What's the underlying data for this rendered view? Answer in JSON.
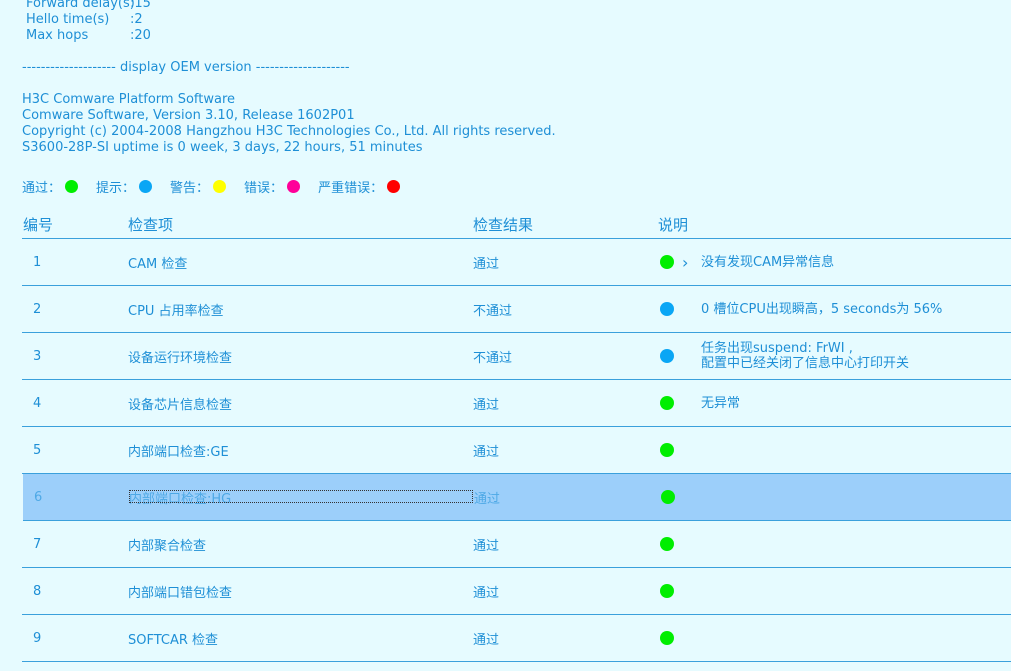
{
  "stp": [
    {
      "label": "Forward delay(s)",
      "value": ":15"
    },
    {
      "label": "Hello time(s)",
      "value": ":2"
    },
    {
      "label": "Max hops",
      "value": ":20"
    }
  ],
  "oem_separator": "-------------------- display OEM version --------------------",
  "version_lines": [
    "H3C Comware Platform Software",
    "Comware Software, Version 3.10, Release 1602P01",
    "Copyright (c) 2004-2008 Hangzhou H3C Technologies Co., Ltd. All rights reserved.",
    "S3600-28P-SI uptime is 0 week, 3 days, 22 hours, 51 minutes"
  ],
  "legend": [
    {
      "label": "通过：",
      "color": "#00ee00"
    },
    {
      "label": "提示：",
      "color": "#0aa6f5"
    },
    {
      "label": "警告：",
      "color": "#ffff00"
    },
    {
      "label": "错误：",
      "color": "#ff0099"
    },
    {
      "label": "严重错误：",
      "color": "#ff0000"
    }
  ],
  "table": {
    "headers": {
      "no": "编号",
      "item": "检查项",
      "result": "检查结果",
      "desc": "说明"
    },
    "rows": [
      {
        "no": "1",
        "item": "CAM 检查",
        "result": "通过",
        "status_color": "#00ee00",
        "arrow": "›",
        "desc": [
          "没有发现CAM异常信息"
        ]
      },
      {
        "no": "2",
        "item": "CPU 占用率检查",
        "result": "不通过",
        "status_color": "#0aa6f5",
        "arrow": "",
        "desc": [
          "0 槽位CPU出现瞬高，5 seconds为 56%"
        ]
      },
      {
        "no": "3",
        "item": "设备运行环境检查",
        "result": "不通过",
        "status_color": "#0aa6f5",
        "arrow": "",
        "desc": [
          "任务出现suspend: FrWI ,",
          "配置中已经关闭了信息中心打印开关"
        ]
      },
      {
        "no": "4",
        "item": "设备芯片信息检查",
        "result": "通过",
        "status_color": "#00ee00",
        "arrow": "",
        "desc": [
          "无异常"
        ]
      },
      {
        "no": "5",
        "item": "内部端口检查:GE",
        "result": "通过",
        "status_color": "#00ee00",
        "arrow": "",
        "desc": []
      },
      {
        "no": "6",
        "item": "内部端口检查:HG",
        "result": "通过",
        "status_color": "#00ee00",
        "arrow": "",
        "desc": [],
        "selected": true
      },
      {
        "no": "7",
        "item": "内部聚合检查",
        "result": "通过",
        "status_color": "#00ee00",
        "arrow": "",
        "desc": []
      },
      {
        "no": "8",
        "item": "内部端口错包检查",
        "result": "通过",
        "status_color": "#00ee00",
        "arrow": "",
        "desc": []
      },
      {
        "no": "9",
        "item": "SOFTCAR 检查",
        "result": "通过",
        "status_color": "#00ee00",
        "arrow": "",
        "desc": []
      }
    ]
  }
}
